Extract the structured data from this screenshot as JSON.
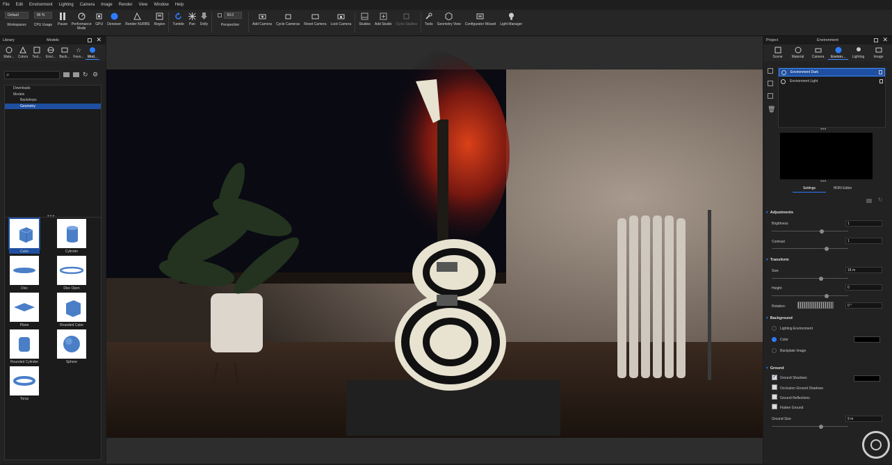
{
  "menu": [
    "File",
    "Edit",
    "Environment",
    "Lighting",
    "Camera",
    "Image",
    "Render",
    "View",
    "Window",
    "Help"
  ],
  "toolbar": {
    "workspace_value": "Default",
    "workspace_label": "Workspaces",
    "cpu_value": "86 %",
    "cpu_label": "CPU Usage",
    "pause": "Pause",
    "performance": "Performance Mode",
    "gpu": "GPU",
    "denoiser": "Denoiser",
    "render_nurbs": "Render NURBS",
    "region": "Region",
    "tumble": "Tumble",
    "pan": "Pan",
    "dolly": "Dolly",
    "fov_value": "50.0",
    "perspective": "Perspective",
    "add_camera": "Add Camera",
    "cycle_cameras": "Cycle Cameras",
    "reset_camera": "Reset Camera",
    "lock_camera": "Lock Camera",
    "studios": "Studios",
    "add_studio": "Add Studio",
    "cycle_studios": "Cycle Studios",
    "tools": "Tools",
    "geometry_view": "Geometry View",
    "configurator_wizard": "Configurator Wizard",
    "light_manager": "Light Manager"
  },
  "library": {
    "title": "Library",
    "center_title": "Models",
    "tabs": [
      "Mate...",
      "Colors",
      "Text...",
      "Envi...",
      "Back...",
      "Favo...",
      "Mod..."
    ],
    "tree": [
      "Downloads",
      "Models",
      "Backdrops",
      "Geometry"
    ],
    "models": [
      "Cube",
      "Cylinder",
      "Disc",
      "Disc Open",
      "Plane",
      "Rounded Cube",
      "Rounded Cylinder",
      "Sphere",
      "Torus"
    ]
  },
  "right": {
    "title": "Project",
    "center_title": "Environment",
    "tabs": [
      "Scene",
      "Material",
      "Camera",
      "Environ...",
      "Lighting",
      "Image"
    ],
    "env_list": [
      "Environment Dark",
      "Environment Light"
    ],
    "subtabs": [
      "Settings",
      "HDRI Editor"
    ],
    "sections": {
      "adjustments": "Adjustments",
      "brightness_label": "Brightness",
      "brightness_value": "1",
      "contrast_label": "Contrast",
      "contrast_value": "1",
      "transform": "Transform",
      "size_label": "Size",
      "size_value": "18 m",
      "height_label": "Height",
      "height_value": "0",
      "rotation_label": "Rotation:",
      "rotation_value": "0 °",
      "background": "Background",
      "bg_opt1": "Lighting Environment",
      "bg_opt2": "Color",
      "bg_opt3": "Backplate Image",
      "ground": "Ground",
      "g1": "Ground Shadows",
      "g2": "Occlusion Ground Shadows",
      "g3": "Ground Reflections",
      "g4": "Flatten Ground",
      "ground_size_label": "Ground Size",
      "ground_size_value": "9 m"
    }
  },
  "colors": {
    "accent": "#2f7bff",
    "selected": "#1f4fa0"
  }
}
